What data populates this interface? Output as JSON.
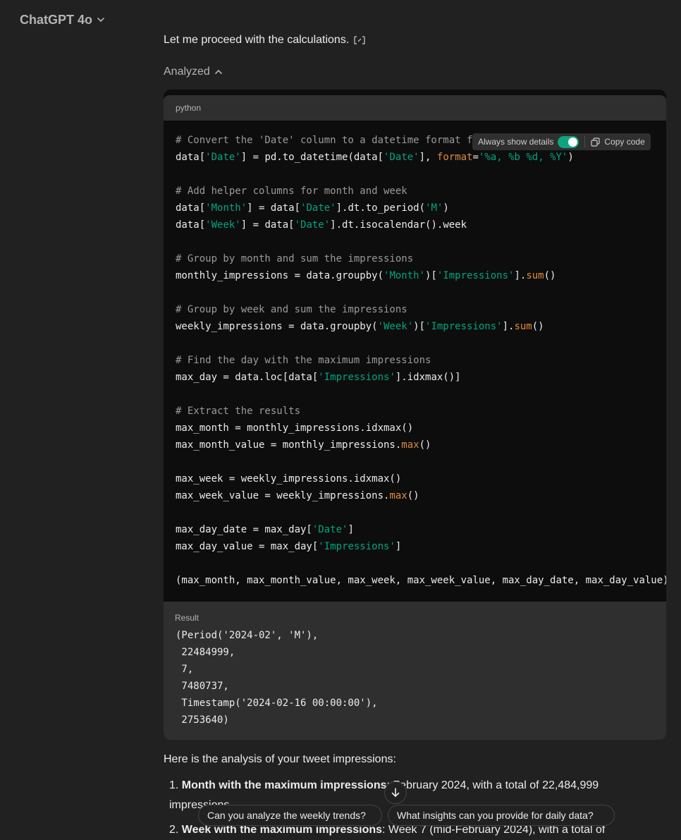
{
  "header": {
    "model_name": "ChatGPT 4o"
  },
  "message": {
    "intro": "Let me proceed with the calculations.",
    "analyzed_label": "Analyzed"
  },
  "code_block": {
    "language": "python",
    "always_show_details_label": "Always show details",
    "always_show_details_on": true,
    "copy_label": "Copy code",
    "lines": [
      [
        [
          "c",
          "# Convert the 'Date' column to a datetime format f"
        ]
      ],
      [
        [
          "p",
          "data["
        ],
        [
          "s",
          "'Date'"
        ],
        [
          "p",
          "] = pd.to_datetime(data["
        ],
        [
          "s",
          "'Date'"
        ],
        [
          "p",
          "], "
        ],
        [
          "k",
          "format"
        ],
        [
          "p",
          "="
        ],
        [
          "s",
          "'%a, %b %d, %Y'"
        ],
        [
          "p",
          ")"
        ]
      ],
      [],
      [
        [
          "c",
          "# Add helper columns for month and week"
        ]
      ],
      [
        [
          "p",
          "data["
        ],
        [
          "s",
          "'Month'"
        ],
        [
          "p",
          "] = data["
        ],
        [
          "s",
          "'Date'"
        ],
        [
          "p",
          "].dt.to_period("
        ],
        [
          "s",
          "'M'"
        ],
        [
          "p",
          ")"
        ]
      ],
      [
        [
          "p",
          "data["
        ],
        [
          "s",
          "'Week'"
        ],
        [
          "p",
          "] = data["
        ],
        [
          "s",
          "'Date'"
        ],
        [
          "p",
          "].dt.isocalendar().week"
        ]
      ],
      [],
      [
        [
          "c",
          "# Group by month and sum the impressions"
        ]
      ],
      [
        [
          "p",
          "monthly_impressions = data.groupby("
        ],
        [
          "s",
          "'Month'"
        ],
        [
          "p",
          ")["
        ],
        [
          "s",
          "'Impressions'"
        ],
        [
          "p",
          "]."
        ],
        [
          "k",
          "sum"
        ],
        [
          "p",
          "()"
        ]
      ],
      [],
      [
        [
          "c",
          "# Group by week and sum the impressions"
        ]
      ],
      [
        [
          "p",
          "weekly_impressions = data.groupby("
        ],
        [
          "s",
          "'Week'"
        ],
        [
          "p",
          ")["
        ],
        [
          "s",
          "'Impressions'"
        ],
        [
          "p",
          "]."
        ],
        [
          "k",
          "sum"
        ],
        [
          "p",
          "()"
        ]
      ],
      [],
      [
        [
          "c",
          "# Find the day with the maximum impressions"
        ]
      ],
      [
        [
          "p",
          "max_day = data.loc[data["
        ],
        [
          "s",
          "'Impressions'"
        ],
        [
          "p",
          "].idxmax()]"
        ]
      ],
      [],
      [
        [
          "c",
          "# Extract the results"
        ]
      ],
      [
        [
          "p",
          "max_month = monthly_impressions.idxmax()"
        ]
      ],
      [
        [
          "p",
          "max_month_value = monthly_impressions."
        ],
        [
          "k",
          "max"
        ],
        [
          "p",
          "()"
        ]
      ],
      [],
      [
        [
          "p",
          "max_week = weekly_impressions.idxmax()"
        ]
      ],
      [
        [
          "p",
          "max_week_value = weekly_impressions."
        ],
        [
          "k",
          "max"
        ],
        [
          "p",
          "()"
        ]
      ],
      [],
      [
        [
          "p",
          "max_day_date = max_day["
        ],
        [
          "s",
          "'Date'"
        ],
        [
          "p",
          "]"
        ]
      ],
      [
        [
          "p",
          "max_day_value = max_day["
        ],
        [
          "s",
          "'Impressions'"
        ],
        [
          "p",
          "]"
        ]
      ],
      [],
      [
        [
          "p",
          "(max_month, max_month_value, max_week, max_week_value, max_day_date, max_day_value)"
        ]
      ]
    ]
  },
  "result": {
    "label": "Result",
    "text": "(Period('2024-02', 'M'),\n 22484999,\n 7,\n 7480737,\n Timestamp('2024-02-16 00:00:00'),\n 2753640)"
  },
  "analysis": {
    "summary": "Here is the analysis of your tweet impressions:",
    "items": [
      {
        "num": "1.",
        "bold": "Month with the maximum impressions",
        "text": ": February 2024, with a total of 22,484,999 impressions."
      },
      {
        "num": "2.",
        "bold": "Week with the maximum impressions",
        "text": ": Week 7 (mid-February 2024), with a total of"
      }
    ]
  },
  "suggestions": [
    "Can you analyze the weekly trends?",
    "What insights can you provide for daily data?"
  ]
}
